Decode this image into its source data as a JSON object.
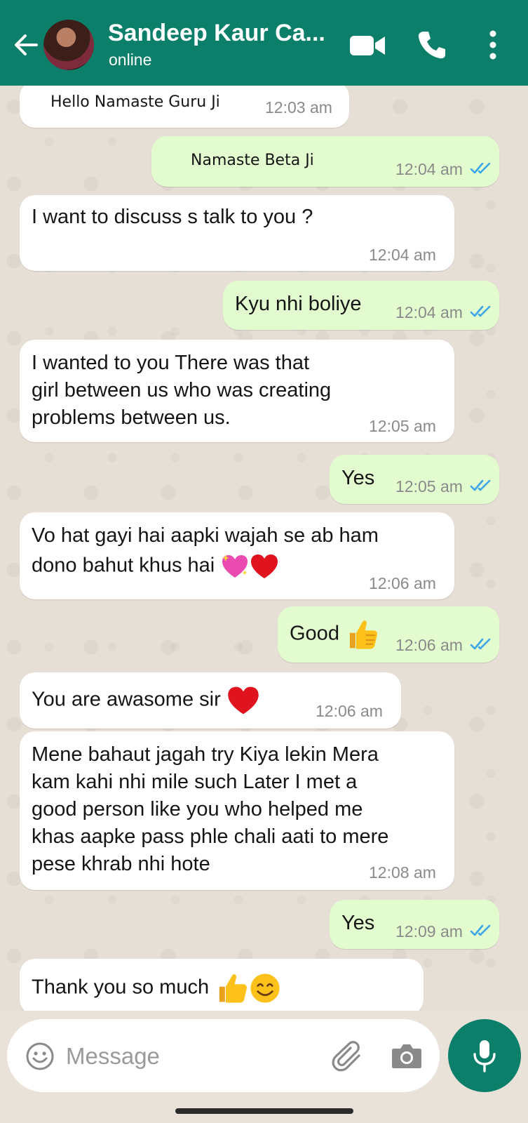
{
  "header": {
    "name": "Sandeep Kaur Ca...",
    "status": "online",
    "colors": {
      "bar": "#0b7f6a"
    }
  },
  "messages": [
    {
      "dir": "in",
      "text": "Hello Namaste Guru Ji",
      "time": "12:03 am"
    },
    {
      "dir": "out",
      "text": "Namaste Beta Ji",
      "time": "12:04 am",
      "ticks": "double-read"
    },
    {
      "dir": "in",
      "text": "I want to discuss s talk to you ?",
      "time": "12:04 am"
    },
    {
      "dir": "out",
      "text": "Kyu nhi boliye",
      "time": "12:04 am",
      "ticks": "double-read"
    },
    {
      "dir": "in",
      "lines": [
        "I wanted to you  There was that",
        "girl between us who was creating",
        "problems between us."
      ],
      "time": "12:05 am"
    },
    {
      "dir": "out",
      "text": "Yes",
      "time": "12:05 am",
      "ticks": "double-read"
    },
    {
      "dir": "in",
      "lines": [
        "Vo hat gayi hai aapki wajah se ab ham",
        "dono bahut khus hai"
      ],
      "emoji": [
        "sparkling-heart",
        "red-heart"
      ],
      "time": "12:06 am"
    },
    {
      "dir": "out",
      "text": "Good",
      "emoji": [
        "thumbs-up"
      ],
      "time": "12:06 am",
      "ticks": "double-read"
    },
    {
      "dir": "in",
      "text": "You are awasome sir",
      "emoji": [
        "red-heart"
      ],
      "time": "12:06 am"
    },
    {
      "dir": "in",
      "lines": [
        "Mene bahaut jagah try Kiya lekin Mera",
        "kam kahi nhi mile such Later I met a",
        "good person like you who helped me",
        "khas aapke pass phle chali aati to mere",
        "pese khrab nhi hote"
      ],
      "time": "12:08 am"
    },
    {
      "dir": "out",
      "text": "Yes",
      "time": "12:09 am",
      "ticks": "double-read"
    },
    {
      "dir": "in",
      "text": "Thank you so much",
      "emoji": [
        "thumbs-up",
        "smiling-face"
      ],
      "time": "",
      "partial": true
    }
  ],
  "composer": {
    "placeholder": "Message",
    "icons": [
      "smiley-icon",
      "attach-icon",
      "camera-icon",
      "mic-icon"
    ]
  }
}
